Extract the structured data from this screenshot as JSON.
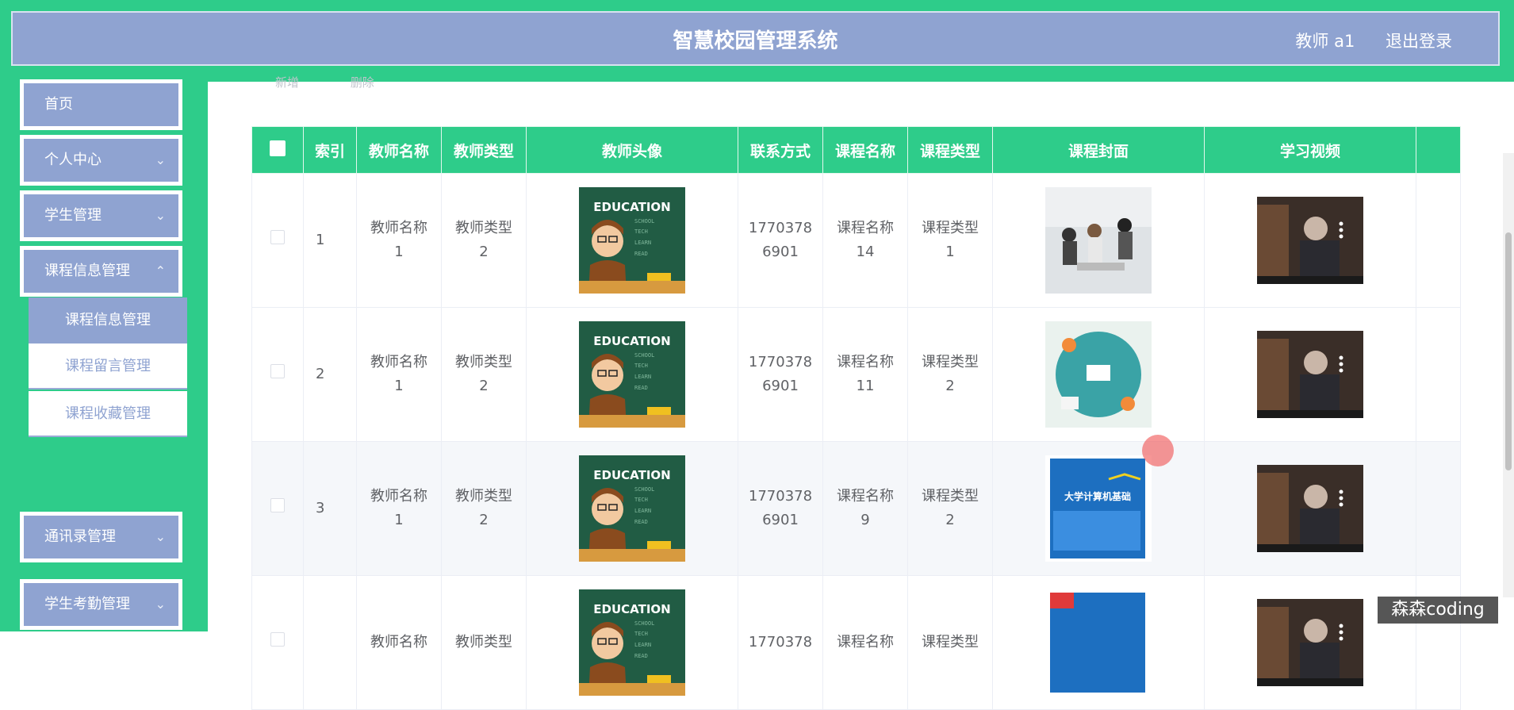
{
  "header": {
    "title": "智慧校园管理系统",
    "user_label": "教师 a1",
    "logout_label": "退出登录"
  },
  "sidebar": {
    "items": [
      {
        "label": "首页"
      },
      {
        "label": "个人中心"
      },
      {
        "label": "学生管理"
      },
      {
        "label": "课程信息管理"
      },
      {
        "label": "通讯录管理"
      },
      {
        "label": "学生考勤管理"
      }
    ],
    "submenu": [
      {
        "label": "课程信息管理",
        "active": true
      },
      {
        "label": "课程留言管理",
        "active": false
      },
      {
        "label": "课程收藏管理",
        "active": false
      }
    ]
  },
  "toolbar": {
    "add_label": "新增",
    "delete_label": "删除"
  },
  "table": {
    "headers": [
      "索引",
      "教师名称",
      "教师类型",
      "教师头像",
      "联系方式",
      "课程名称",
      "课程类型",
      "课程封面",
      "学习视频"
    ],
    "rows": [
      {
        "index": "1",
        "teacher_name": [
          "教师名称",
          "1"
        ],
        "teacher_type": [
          "教师类型",
          "2"
        ],
        "phone": [
          "1770378",
          "6901"
        ],
        "course_name": [
          "课程名称",
          "14"
        ],
        "course_type": [
          "课程类型",
          "1"
        ]
      },
      {
        "index": "2",
        "teacher_name": [
          "教师名称",
          "1"
        ],
        "teacher_type": [
          "教师类型",
          "2"
        ],
        "phone": [
          "1770378",
          "6901"
        ],
        "course_name": [
          "课程名称",
          "11"
        ],
        "course_type": [
          "课程类型",
          "2"
        ]
      },
      {
        "index": "3",
        "teacher_name": [
          "教师名称",
          "1"
        ],
        "teacher_type": [
          "教师类型",
          "2"
        ],
        "phone": [
          "1770378",
          "6901"
        ],
        "course_name": [
          "课程名称",
          "9"
        ],
        "course_type": [
          "课程类型",
          "2"
        ]
      },
      {
        "index": "",
        "teacher_name": [
          "教师名称",
          ""
        ],
        "teacher_type": [
          "教师类型",
          ""
        ],
        "phone": [
          "1770378",
          ""
        ],
        "course_name": [
          "课程名称",
          ""
        ],
        "course_type": [
          "课程类型",
          ""
        ]
      }
    ]
  },
  "avatar_text": "EDUCATION",
  "book_title": "大学计算机基础",
  "watermark": "森森coding",
  "colors": {
    "accent": "#2ecc8a",
    "menu": "#8fa3d1"
  }
}
